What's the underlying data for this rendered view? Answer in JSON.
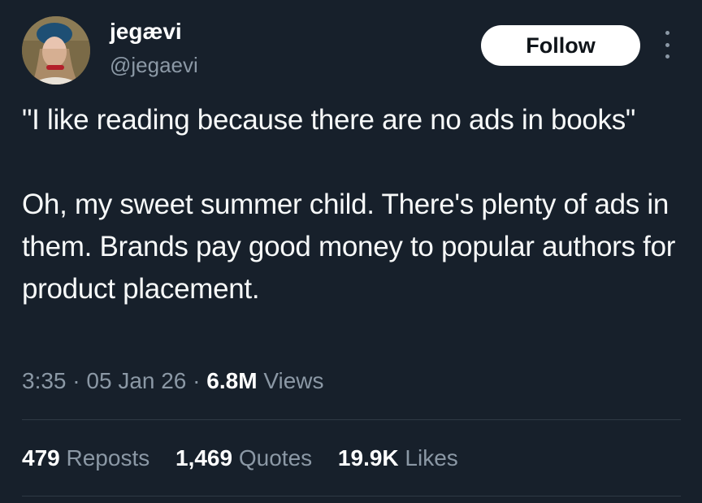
{
  "author": {
    "display_name": "jegævi",
    "handle": "@jegaevi"
  },
  "follow_label": "Follow",
  "tweet_text": "\"I like reading because there are no ads in books\"\n\nOh, my sweet summer child. There's plenty of ads in them. Brands pay good money to popular authors for product placement.",
  "meta": {
    "time": "3:35",
    "separator": "·",
    "date": "05 Jan 26",
    "views_count": "6.8M",
    "views_label": "Views"
  },
  "stats": {
    "reposts_count": "479",
    "reposts_label": "Reposts",
    "quotes_count": "1,469",
    "quotes_label": "Quotes",
    "likes_count": "19.9K",
    "likes_label": "Likes"
  },
  "colors": {
    "background": "#17202b",
    "text": "#f7f9f9",
    "secondary_text": "#8b98a5",
    "button_bg": "#ffffff",
    "divider": "#2f3a45"
  },
  "icons": [
    "more-vertical-icon"
  ]
}
